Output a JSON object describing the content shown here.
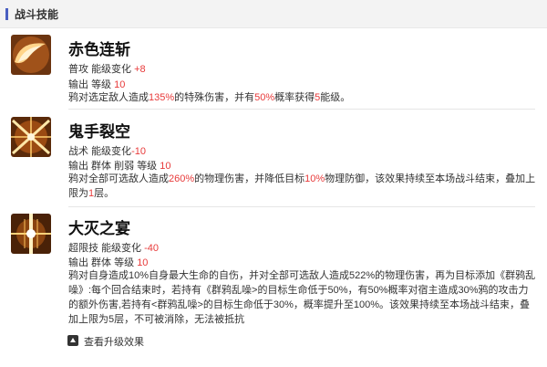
{
  "section": {
    "title": "战斗技能"
  },
  "skills": [
    {
      "name": "赤色连斩",
      "type": "普攻",
      "energy_label": "能级变化",
      "energy_value": "+8",
      "tags": "输出",
      "level_label": "等级",
      "level": "10",
      "desc": [
        {
          "t": "鸦对选定敌人造成"
        },
        {
          "t": "135%",
          "r": true
        },
        {
          "t": "的特殊伤害，并有"
        },
        {
          "t": "50%",
          "r": true
        },
        {
          "t": "概率获得"
        },
        {
          "t": "5",
          "r": true
        },
        {
          "t": "能级。"
        }
      ]
    },
    {
      "name": "鬼手裂空",
      "type": "战术",
      "energy_label": "能级变化",
      "energy_value": "-10",
      "tags": "输出 群体 削弱",
      "level_label": "等级",
      "level": "10",
      "desc": [
        {
          "t": "鸦对全部可选敌人造成"
        },
        {
          "t": "260%",
          "r": true
        },
        {
          "t": "的物理伤害，并降低目标"
        },
        {
          "t": "10%",
          "r": true
        },
        {
          "t": "物理防御，该效果持续至本场战斗结束，叠加上限为"
        },
        {
          "t": "1",
          "r": true
        },
        {
          "t": "层。"
        }
      ]
    },
    {
      "name": "大灭之宴",
      "type": "超限技",
      "energy_label": "能级变化",
      "energy_value": "-40",
      "tags": "输出 群体",
      "level_label": "等级",
      "level": "10",
      "desc": [
        {
          "t": "鸦对自身造成10%自身最大生命的自伤，并对全部可选敌人造成522%的物理伤害，再为目标添加《群鸦乱噪》:每个回合结束时，若持有《群鸦乱噪>的目标生命低于50%，有50%概率对宿主造成30%鸦的攻击力的额外伤害,若持有<群鸦乱噪>的目标生命低于30%，概率提升至100%。该效果持续至本场战斗结束，叠加上限为5层，不可被消除，无法被抵抗"
        }
      ]
    }
  ],
  "upgrade": {
    "label": "查看升级效果",
    "icon": "up-arrow-icon"
  }
}
